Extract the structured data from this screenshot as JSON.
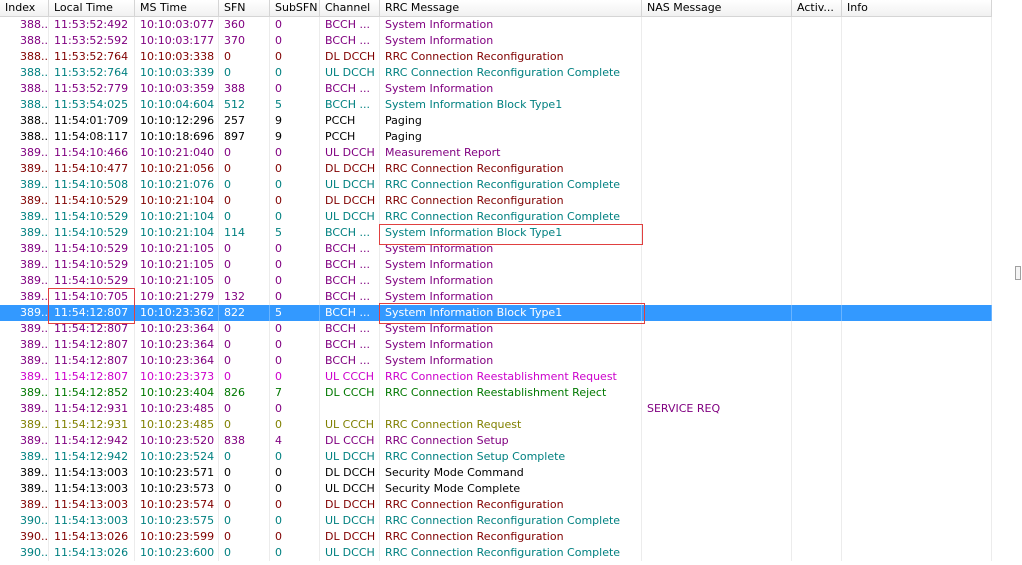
{
  "columns": [
    "Index",
    "Local Time",
    "MS Time",
    "SFN",
    "SubSFN",
    "Channel",
    "RRC Message",
    "NAS Message",
    "Activ...",
    "Info"
  ],
  "colors": {
    "purple": "#800080",
    "maroon": "#800000",
    "teal": "#008080",
    "black": "#000000",
    "magenta": "#cc00cc",
    "green": "#007800",
    "olive": "#808000",
    "selection": "#3399ff",
    "highlight_box": "#e04040"
  },
  "rows": [
    {
      "index": "388...",
      "local": "11:53:52:492",
      "ms": "10:10:03:077",
      "sfn": "360",
      "subsfn": "0",
      "channel": "BCCH ...",
      "rrc": "System Information",
      "nas": "",
      "color": "purple"
    },
    {
      "index": "388...",
      "local": "11:53:52:592",
      "ms": "10:10:03:177",
      "sfn": "370",
      "subsfn": "0",
      "channel": "BCCH ...",
      "rrc": "System Information",
      "nas": "",
      "color": "purple"
    },
    {
      "index": "388...",
      "local": "11:53:52:764",
      "ms": "10:10:03:338",
      "sfn": "0",
      "subsfn": "0",
      "channel": "DL DCCH",
      "rrc": "RRC Connection Reconfiguration",
      "nas": "",
      "color": "maroon"
    },
    {
      "index": "388...",
      "local": "11:53:52:764",
      "ms": "10:10:03:339",
      "sfn": "0",
      "subsfn": "0",
      "channel": "UL DCCH",
      "rrc": "RRC Connection Reconfiguration Complete",
      "nas": "",
      "color": "teal"
    },
    {
      "index": "388...",
      "local": "11:53:52:779",
      "ms": "10:10:03:359",
      "sfn": "388",
      "subsfn": "0",
      "channel": "BCCH ...",
      "rrc": "System Information",
      "nas": "",
      "color": "purple"
    },
    {
      "index": "388...",
      "local": "11:53:54:025",
      "ms": "10:10:04:604",
      "sfn": "512",
      "subsfn": "5",
      "channel": "BCCH ...",
      "rrc": "System Information Block Type1",
      "nas": "",
      "color": "teal"
    },
    {
      "index": "388...",
      "local": "11:54:01:709",
      "ms": "10:10:12:296",
      "sfn": "257",
      "subsfn": "9",
      "channel": "PCCH",
      "rrc": "Paging",
      "nas": "",
      "color": "black"
    },
    {
      "index": "388...",
      "local": "11:54:08:117",
      "ms": "10:10:18:696",
      "sfn": "897",
      "subsfn": "9",
      "channel": "PCCH",
      "rrc": "Paging",
      "nas": "",
      "color": "black"
    },
    {
      "index": "389...",
      "local": "11:54:10:466",
      "ms": "10:10:21:040",
      "sfn": "0",
      "subsfn": "0",
      "channel": "UL DCCH",
      "rrc": "Measurement Report",
      "nas": "",
      "color": "purple"
    },
    {
      "index": "389...",
      "local": "11:54:10:477",
      "ms": "10:10:21:056",
      "sfn": "0",
      "subsfn": "0",
      "channel": "DL DCCH",
      "rrc": "RRC Connection Reconfiguration",
      "nas": "",
      "color": "maroon"
    },
    {
      "index": "389...",
      "local": "11:54:10:508",
      "ms": "10:10:21:076",
      "sfn": "0",
      "subsfn": "0",
      "channel": "UL DCCH",
      "rrc": "RRC Connection Reconfiguration Complete",
      "nas": "",
      "color": "teal"
    },
    {
      "index": "389...",
      "local": "11:54:10:529",
      "ms": "10:10:21:104",
      "sfn": "0",
      "subsfn": "0",
      "channel": "DL DCCH",
      "rrc": "RRC Connection Reconfiguration",
      "nas": "",
      "color": "maroon"
    },
    {
      "index": "389...",
      "local": "11:54:10:529",
      "ms": "10:10:21:104",
      "sfn": "0",
      "subsfn": "0",
      "channel": "UL DCCH",
      "rrc": "RRC Connection Reconfiguration Complete",
      "nas": "",
      "color": "teal"
    },
    {
      "index": "389...",
      "local": "11:54:10:529",
      "ms": "10:10:21:104",
      "sfn": "114",
      "subsfn": "5",
      "channel": "BCCH ...",
      "rrc": "System Information Block Type1",
      "nas": "",
      "color": "teal"
    },
    {
      "index": "389...",
      "local": "11:54:10:529",
      "ms": "10:10:21:105",
      "sfn": "0",
      "subsfn": "0",
      "channel": "BCCH ...",
      "rrc": "System Information",
      "nas": "",
      "color": "purple"
    },
    {
      "index": "389...",
      "local": "11:54:10:529",
      "ms": "10:10:21:105",
      "sfn": "0",
      "subsfn": "0",
      "channel": "BCCH ...",
      "rrc": "System Information",
      "nas": "",
      "color": "purple"
    },
    {
      "index": "389...",
      "local": "11:54:10:529",
      "ms": "10:10:21:105",
      "sfn": "0",
      "subsfn": "0",
      "channel": "BCCH ...",
      "rrc": "System Information",
      "nas": "",
      "color": "purple"
    },
    {
      "index": "389...",
      "local": "11:54:10:705",
      "ms": "10:10:21:279",
      "sfn": "132",
      "subsfn": "0",
      "channel": "BCCH ...",
      "rrc": "System Information",
      "nas": "",
      "color": "purple"
    },
    {
      "index": "389...",
      "local": "11:54:12:807",
      "ms": "10:10:23:362",
      "sfn": "822",
      "subsfn": "5",
      "channel": "BCCH ...",
      "rrc": "System Information Block Type1",
      "nas": "",
      "color": "teal",
      "selected": true
    },
    {
      "index": "389...",
      "local": "11:54:12:807",
      "ms": "10:10:23:364",
      "sfn": "0",
      "subsfn": "0",
      "channel": "BCCH ...",
      "rrc": "System Information",
      "nas": "",
      "color": "purple"
    },
    {
      "index": "389...",
      "local": "11:54:12:807",
      "ms": "10:10:23:364",
      "sfn": "0",
      "subsfn": "0",
      "channel": "BCCH ...",
      "rrc": "System Information",
      "nas": "",
      "color": "purple"
    },
    {
      "index": "389...",
      "local": "11:54:12:807",
      "ms": "10:10:23:364",
      "sfn": "0",
      "subsfn": "0",
      "channel": "BCCH ...",
      "rrc": "System Information",
      "nas": "",
      "color": "purple"
    },
    {
      "index": "389...",
      "local": "11:54:12:807",
      "ms": "10:10:23:373",
      "sfn": "0",
      "subsfn": "0",
      "channel": "UL CCCH",
      "rrc": "RRC Connection Reestablishment Request",
      "nas": "",
      "color": "magenta"
    },
    {
      "index": "389...",
      "local": "11:54:12:852",
      "ms": "10:10:23:404",
      "sfn": "826",
      "subsfn": "7",
      "channel": "DL CCCH",
      "rrc": "RRC Connection Reestablishment Reject",
      "nas": "",
      "color": "green"
    },
    {
      "index": "389...",
      "local": "11:54:12:931",
      "ms": "10:10:23:485",
      "sfn": "0",
      "subsfn": "0",
      "channel": "",
      "rrc": "",
      "nas": "SERVICE REQ",
      "color": "purple"
    },
    {
      "index": "389...",
      "local": "11:54:12:931",
      "ms": "10:10:23:485",
      "sfn": "0",
      "subsfn": "0",
      "channel": "UL CCCH",
      "rrc": "RRC Connection Request",
      "nas": "",
      "color": "olive"
    },
    {
      "index": "389...",
      "local": "11:54:12:942",
      "ms": "10:10:23:520",
      "sfn": "838",
      "subsfn": "4",
      "channel": "DL CCCH",
      "rrc": "RRC Connection Setup",
      "nas": "",
      "color": "purple"
    },
    {
      "index": "389...",
      "local": "11:54:12:942",
      "ms": "10:10:23:524",
      "sfn": "0",
      "subsfn": "0",
      "channel": "UL DCCH",
      "rrc": "RRC Connection Setup Complete",
      "nas": "",
      "color": "teal"
    },
    {
      "index": "389...",
      "local": "11:54:13:003",
      "ms": "10:10:23:571",
      "sfn": "0",
      "subsfn": "0",
      "channel": "DL DCCH",
      "rrc": "Security Mode Command",
      "nas": "",
      "color": "black"
    },
    {
      "index": "389...",
      "local": "11:54:13:003",
      "ms": "10:10:23:573",
      "sfn": "0",
      "subsfn": "0",
      "channel": "UL DCCH",
      "rrc": "Security Mode Complete",
      "nas": "",
      "color": "black"
    },
    {
      "index": "389...",
      "local": "11:54:13:003",
      "ms": "10:10:23:574",
      "sfn": "0",
      "subsfn": "0",
      "channel": "DL DCCH",
      "rrc": "RRC Connection Reconfiguration",
      "nas": "",
      "color": "maroon"
    },
    {
      "index": "390...",
      "local": "11:54:13:003",
      "ms": "10:10:23:575",
      "sfn": "0",
      "subsfn": "0",
      "channel": "UL DCCH",
      "rrc": "RRC Connection Reconfiguration Complete",
      "nas": "",
      "color": "teal"
    },
    {
      "index": "390...",
      "local": "11:54:13:026",
      "ms": "10:10:23:599",
      "sfn": "0",
      "subsfn": "0",
      "channel": "DL DCCH",
      "rrc": "RRC Connection Reconfiguration",
      "nas": "",
      "color": "maroon"
    },
    {
      "index": "390...",
      "local": "11:54:13:026",
      "ms": "10:10:23:600",
      "sfn": "0",
      "subsfn": "0",
      "channel": "UL DCCH",
      "rrc": "RRC Connection Reconfiguration Complete",
      "nas": "",
      "color": "teal"
    }
  ]
}
